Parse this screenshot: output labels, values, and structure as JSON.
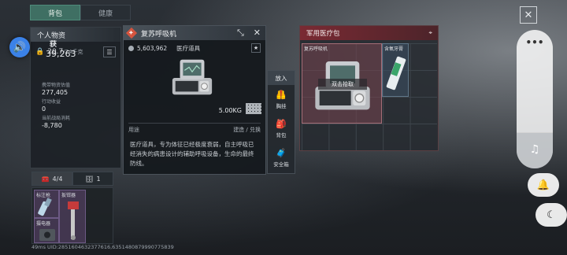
{
  "tabs": [
    {
      "label": "背包",
      "active": true
    },
    {
      "label": "健康",
      "active": false
    }
  ],
  "personal": {
    "title": "个人物资",
    "weight": "20.7",
    "weight_unit": "/74千克",
    "fund_label_top": "获",
    "fund_value": "39,263",
    "stats": [
      {
        "label": "携带物资估值",
        "value": "277,405"
      },
      {
        "label": "行动收益",
        "value": "0"
      },
      {
        "label": "当前战局消耗",
        "value": "-8,780"
      }
    ]
  },
  "counts": {
    "kit": "4/4",
    "case": "1"
  },
  "backpack_items": [
    {
      "name": "标注枪"
    },
    {
      "name": "扳钳器"
    },
    {
      "name": "摄电器"
    }
  ],
  "status_line": "49ms  UID:2851604632377616,6351480879990775839",
  "detail": {
    "title": "复苏呼吸机",
    "value": "5,603,962",
    "category": "医疗道具",
    "weight": "5.00KG",
    "usage_label": "用途",
    "usage_right": "建造 / 兑换",
    "description": "医疗道具，专为体征已经极度衰弱，自主呼吸已经消失的病患设计的辅助呼吸设备，生命的最终防线。"
  },
  "actions": {
    "header": "放入",
    "items": [
      {
        "label": "胸挂",
        "icon": "vest-icon"
      },
      {
        "label": "背包",
        "icon": "backpack-icon"
      },
      {
        "label": "安全箱",
        "icon": "safe-box-icon"
      }
    ]
  },
  "medkit": {
    "title": "军用医疗包",
    "selected_item": "复苏呼吸机",
    "pickup_label": "双击拾取",
    "second_item": "含氧牙膏"
  },
  "colors": {
    "accent_tab": "#3f6f63",
    "medkit_header": "#7a2a33",
    "rarity_purple": "#6d5a85",
    "speaker_blue": "#3b82e8"
  }
}
